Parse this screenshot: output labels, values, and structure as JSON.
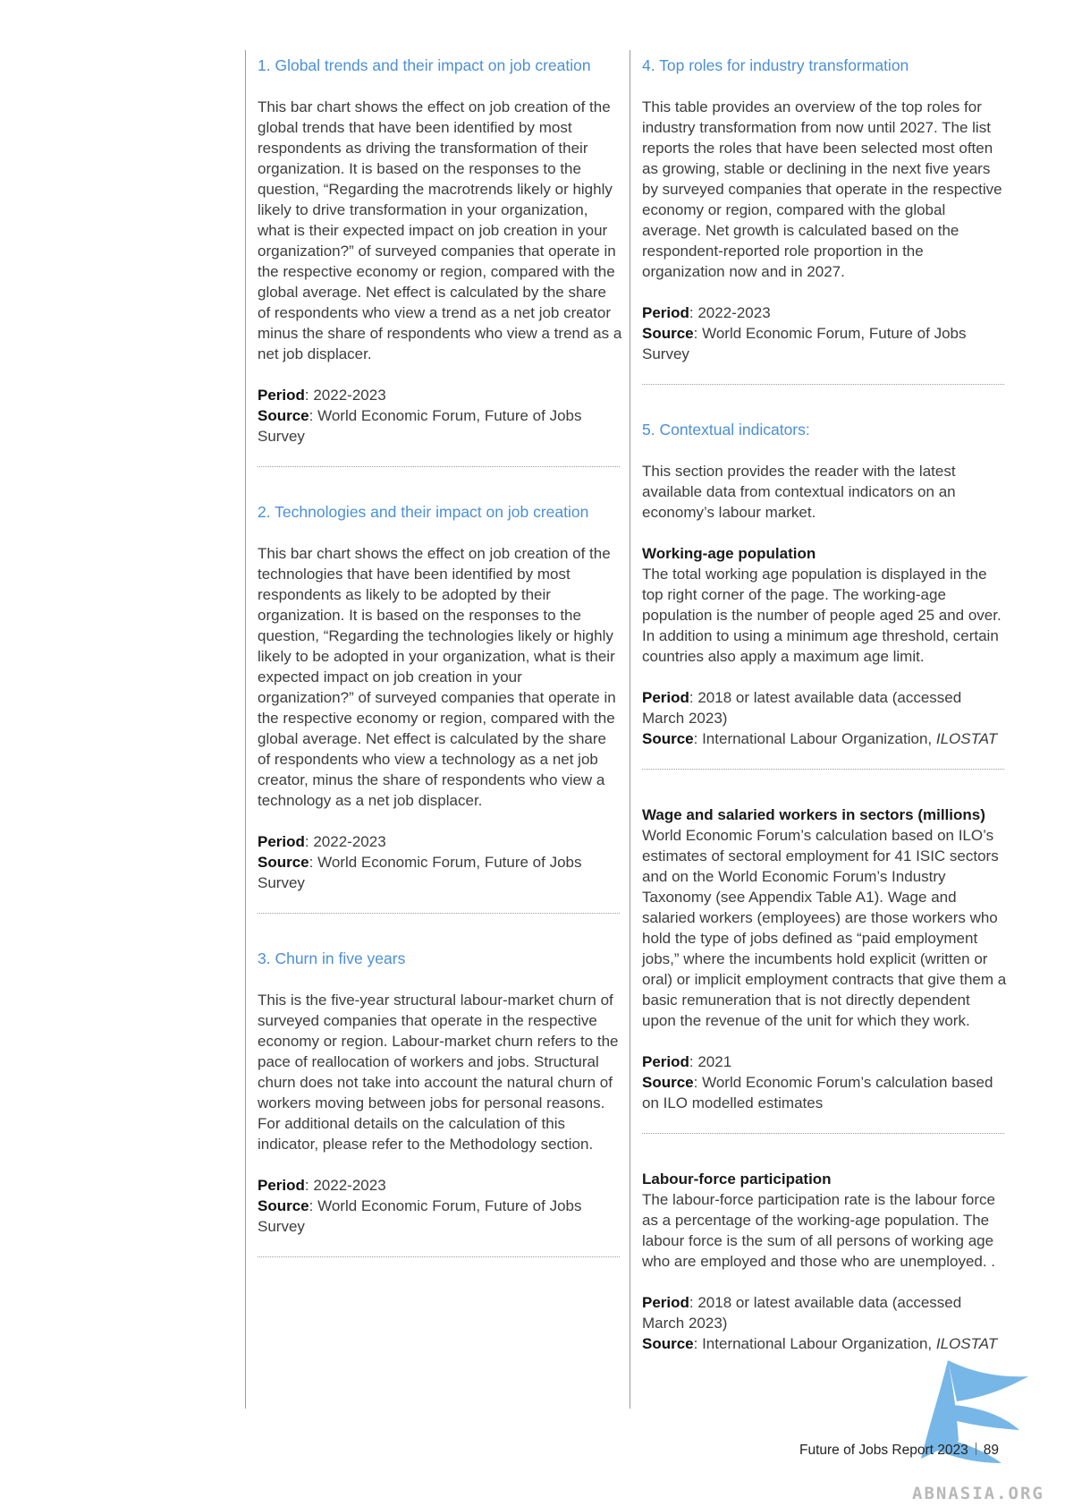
{
  "sections": {
    "s1": {
      "title": "1. Global trends and their impact on job creation",
      "body": "This bar chart shows the effect on job creation of the global trends that have been identified by most respondents as driving the transformation of their organization. It is based on the responses to the question, “Regarding the macrotrends likely or highly likely to drive transformation in your organization, what is their expected impact on job creation in your organization?” of surveyed companies that operate in the respective economy or region, compared with the global average. Net effect is calculated by the share of respondents who view a trend as a net job creator minus the share of respondents who view a trend as a net job displacer.",
      "period_label": "Period",
      "period": ": 2022-2023",
      "source_label": "Source",
      "source": ": World Economic Forum, Future of Jobs Survey"
    },
    "s2": {
      "title": "2. Technologies and their impact on job creation",
      "body": "This bar chart shows the effect on job creation of the technologies that have been identified by most respondents as likely to be adopted by their organization. It is based on the responses to the question, “Regarding the technologies likely or highly likely to be adopted in your organization, what is their expected impact on job creation in your organization?” of surveyed companies that operate in the respective economy or region, compared with the global average. Net effect is calculated by the share of respondents who view a technology as a net job creator, minus the share of respondents who view a technology as a net job displacer.",
      "period_label": "Period",
      "period": ": 2022-2023",
      "source_label": "Source",
      "source": ": World Economic Forum, Future of Jobs Survey"
    },
    "s3": {
      "title": "3. Churn in five years",
      "body": "This is the five-year structural labour-market churn of surveyed companies that operate in the respective economy or region. Labour-market churn refers to the pace of reallocation of workers and jobs. Structural churn does not take into account the natural churn of workers moving between jobs for personal reasons. For additional details on the calculation of this indicator, please refer to the Methodology section.",
      "period_label": "Period",
      "period": ": 2022-2023",
      "source_label": "Source",
      "source": ": World Economic Forum, Future of Jobs Survey"
    },
    "s4": {
      "title": "4. Top roles for industry transformation",
      "body": "This table provides an overview of the top roles for industry transformation from now until 2027. The list reports the roles that have been selected most often as growing, stable or declining in the next five years by surveyed companies that operate in the respective economy or region, compared with the global average. Net growth is calculated based on the respondent-reported role proportion in the organization now and in 2027.",
      "period_label": "Period",
      "period": ": 2022-2023",
      "source_label": "Source",
      "source": ": World Economic Forum, Future of Jobs Survey"
    },
    "s5": {
      "title": "5. Contextual indicators:",
      "body": "This section provides the reader with the latest available data from contextual indicators on an economy’s labour market.",
      "working_age": {
        "title": "Working-age population",
        "body": "The total working age population is displayed in the top right corner of the page. The working-age population is the number of people aged 25 and over. In addition to using a minimum age threshold, certain countries also apply a maximum age limit.",
        "period_label": "Period",
        "period": ": 2018 or latest available data (accessed March 2023)",
        "source_label": "Source",
        "source": ": International Labour Organization, ",
        "source_italic": "ILOSTAT"
      },
      "wage": {
        "title": "Wage and salaried workers in sectors (millions)",
        "body": "World Economic Forum’s calculation based on ILO’s estimates of sectoral employment for 41 ISIC sectors and on the World Economic Forum’s Industry Taxonomy (see Appendix Table A1). Wage and salaried workers (employees) are those workers who hold the type of jobs defined as “paid employment jobs,” where the incumbents hold explicit (written or oral) or implicit employment contracts that give them a basic remuneration that is not directly dependent upon the revenue of the unit for which they work.",
        "period_label": "Period",
        "period": ": 2021",
        "source_label": "Source",
        "source": ": World Economic Forum’s calculation based on ILO modelled estimates"
      },
      "labour_force": {
        "title": "Labour-force participation",
        "body": "The labour-force participation rate is the labour force as a percentage of the working-age population. The labour force is the sum of all persons of working age who are employed and those who are unemployed. .",
        "period_label": "Period",
        "period": ": 2018 or latest available data (accessed March 2023)",
        "source_label": "Source",
        "source": ": International Labour Organization, ",
        "source_italic": "ILOSTAT"
      }
    }
  },
  "footer": {
    "report_title": "Future of Jobs Report 2023",
    "page_number": "89"
  },
  "watermark": {
    "text": "ABNASIA.ORG",
    "color": "#4a9fe0"
  }
}
